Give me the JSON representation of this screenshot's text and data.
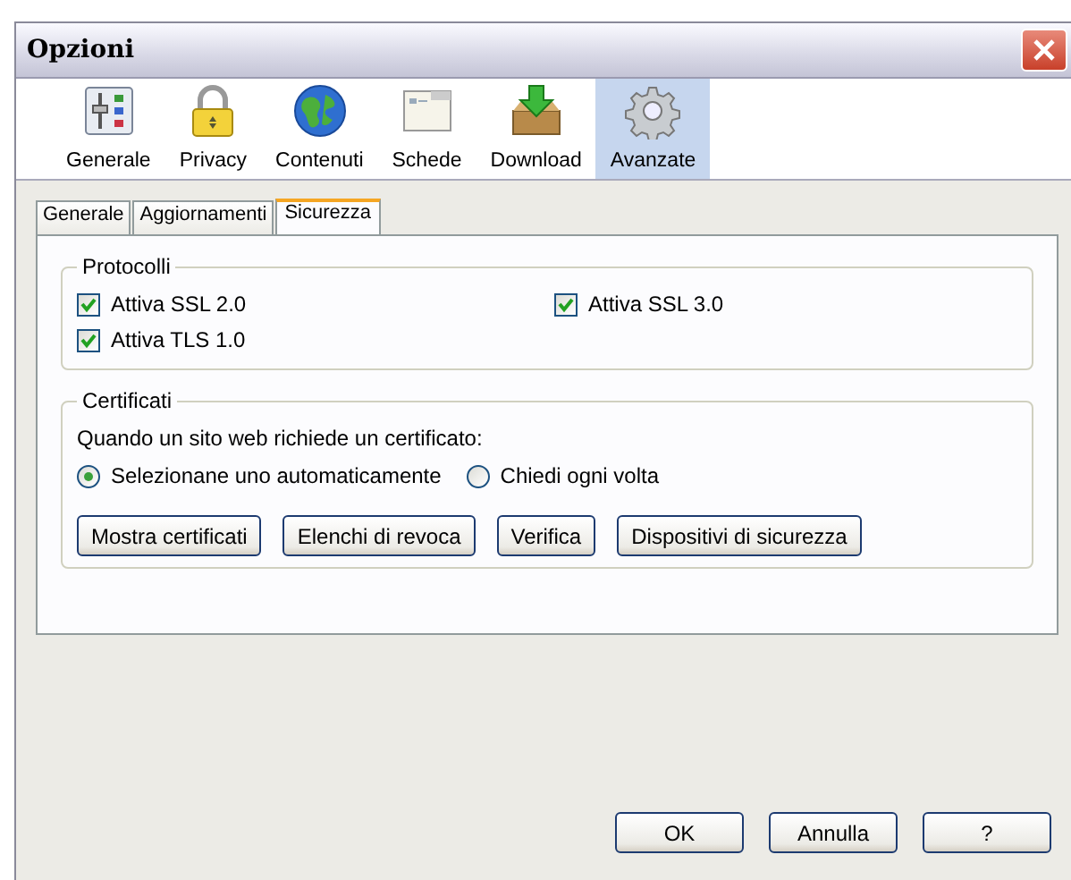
{
  "window": {
    "title": "Opzioni"
  },
  "toolbar": [
    {
      "label": "Generale",
      "selected": false
    },
    {
      "label": "Privacy",
      "selected": false
    },
    {
      "label": "Contenuti",
      "selected": false
    },
    {
      "label": "Schede",
      "selected": false
    },
    {
      "label": "Download",
      "selected": false
    },
    {
      "label": "Avanzate",
      "selected": true
    }
  ],
  "tabs": [
    {
      "label": "Generale",
      "selected": false
    },
    {
      "label": "Aggiornamenti",
      "selected": false
    },
    {
      "label": "Sicurezza",
      "selected": true
    }
  ],
  "protocols": {
    "title": "Protocolli",
    "options": [
      {
        "label": "Attiva SSL 2.0",
        "checked": true
      },
      {
        "label": "Attiva SSL 3.0",
        "checked": true
      },
      {
        "label": "Attiva TLS 1.0",
        "checked": true
      }
    ]
  },
  "certificates": {
    "title": "Certificati",
    "prompt": "Quando un sito web richiede un certificato:",
    "choices": [
      {
        "label": "Selezionane uno automaticamente",
        "selected": true
      },
      {
        "label": "Chiedi ogni volta",
        "selected": false
      }
    ],
    "buttons": [
      "Mostra certificati",
      "Elenchi di revoca",
      "Verifica",
      "Dispositivi di sicurezza"
    ]
  },
  "dialog_buttons": [
    "OK",
    "Annulla",
    "?"
  ]
}
